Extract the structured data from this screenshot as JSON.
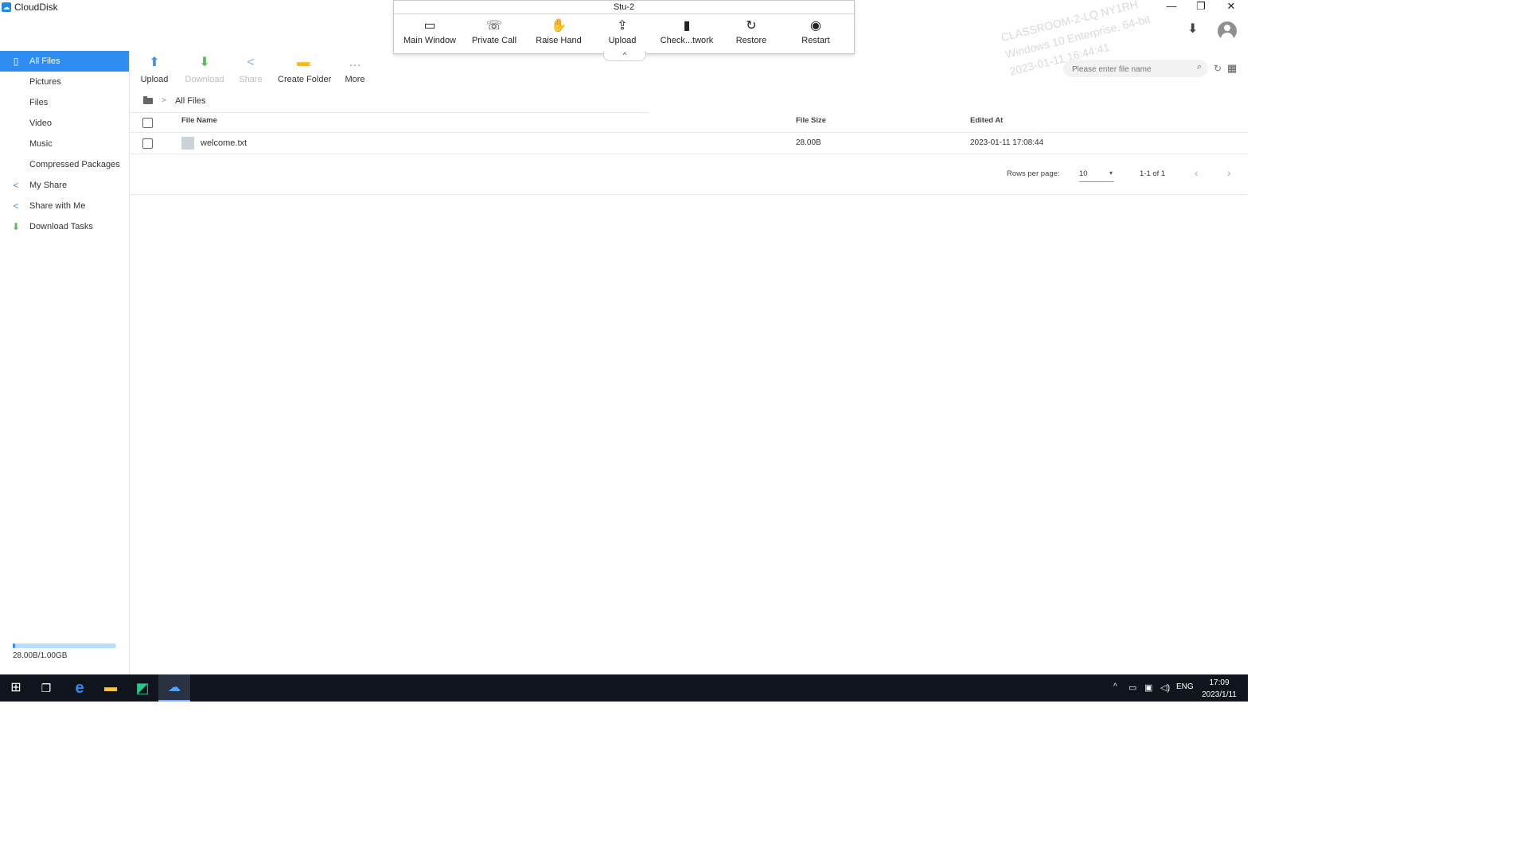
{
  "app": {
    "title": "CloudDisk",
    "logo_glyph": "☁",
    "window_controls": {
      "minimize": "—",
      "restore": "❐",
      "close": "✕"
    },
    "watermark": [
      "CLASSROOM-2-LQ NY1RH",
      "Windows 10 Enterprise, 64-bit",
      "2023-01-11 16:44:41"
    ]
  },
  "remote_toolbar": {
    "title": "Stu-2",
    "buttons": [
      {
        "label": "Main Window",
        "icon": "▭"
      },
      {
        "label": "Private Call",
        "icon": "☏"
      },
      {
        "label": "Raise Hand",
        "icon": "✋"
      },
      {
        "label": "Upload",
        "icon": "⇪"
      },
      {
        "label": "Check...twork",
        "icon": "▮"
      },
      {
        "label": "Restore",
        "icon": "↻"
      },
      {
        "label": "Restart",
        "icon": "◉"
      }
    ],
    "collapse_glyph": "^"
  },
  "sidebar": {
    "items": [
      {
        "label": "All Files",
        "icon": "▯",
        "active": true
      },
      {
        "label": "Pictures",
        "icon": ""
      },
      {
        "label": "Files",
        "icon": ""
      },
      {
        "label": "Video",
        "icon": ""
      },
      {
        "label": "Music",
        "icon": ""
      },
      {
        "label": "Compressed Packages",
        "icon": ""
      },
      {
        "label": "My Share",
        "icon": "<"
      },
      {
        "label": "Share with Me",
        "icon": "<"
      },
      {
        "label": "Download Tasks",
        "icon": "⬇"
      }
    ],
    "storage": {
      "text": "28.00B/1.00GB",
      "used_fraction": 0.02
    }
  },
  "toolbar": {
    "upload": {
      "label": "Upload",
      "icon": "⬆",
      "color": "#4a90e2"
    },
    "download": {
      "label": "Download",
      "icon": "⬇",
      "color": "#5cb85c"
    },
    "share": {
      "label": "Share",
      "icon": "<",
      "color": "#7fb6ea"
    },
    "create_folder": {
      "label": "Create Folder",
      "icon": "▬",
      "color": "#f5b921"
    },
    "more": {
      "label": "More",
      "icon": "…",
      "color": "#999999"
    }
  },
  "search": {
    "placeholder": "Please enter file name",
    "icon": "⌕"
  },
  "header_icons": {
    "download": "⬇",
    "refresh": "↻",
    "grid": "▦"
  },
  "breadcrumb": {
    "separator": ">",
    "current": "All Files"
  },
  "table": {
    "columns": {
      "name": "File Name",
      "size": "File Size",
      "edited": "Edited At"
    },
    "rows": [
      {
        "name": "welcome.txt",
        "size": "28.00B",
        "edited": "2023-01-11 17:08:44"
      }
    ]
  },
  "pagination": {
    "rows_per_page_label": "Rows per page:",
    "rows_per_page": "10",
    "dropdown_glyph": "▾",
    "range": "1-1 of 1",
    "prev": "‹",
    "next": "›"
  },
  "taskbar": {
    "start": "⊞",
    "task_view": "❐",
    "edge": "e",
    "explorer": "▬",
    "app1": "◩",
    "app2": "☁",
    "tray_chevron": "^",
    "language": "ENG",
    "time": "17:09",
    "date": "2023/1/11"
  }
}
